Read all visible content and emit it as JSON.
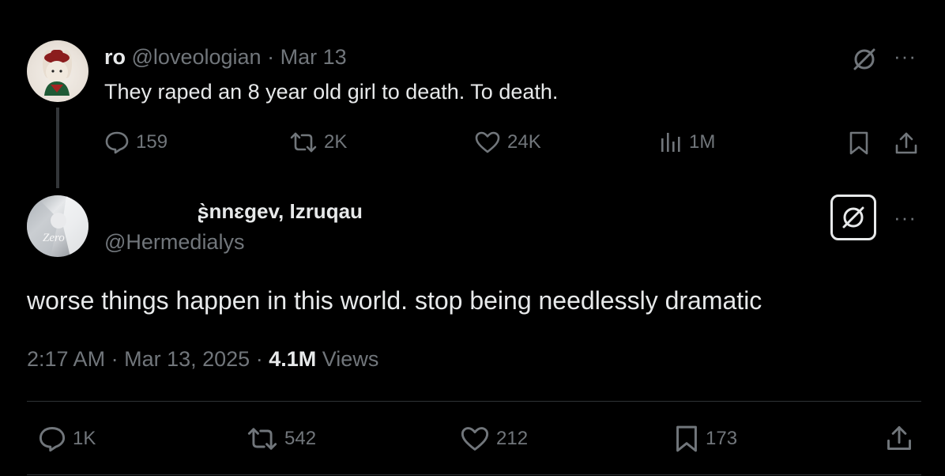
{
  "parent_tweet": {
    "display_name": "ro",
    "handle": "@loveologian",
    "separator": "·",
    "date": "Mar 13",
    "text": "They raped an 8 year old girl to death. To death.",
    "replies": "159",
    "reposts": "2K",
    "likes": "24K",
    "views": "1M"
  },
  "reply_tweet": {
    "display_name": "ʂ̀nnɛgev, Izruqau",
    "handle": "@Hermedialys",
    "text": "worse things happen in this world. stop being needlessly dramatic",
    "time": "2:17 AM",
    "separator": "·",
    "date": "Mar 13, 2025",
    "views_count": "4.1M",
    "views_label": "Views",
    "replies": "1K",
    "reposts": "542",
    "likes": "212",
    "bookmarks": "173"
  },
  "icons": {
    "reply": "comment-icon",
    "repost": "repost-icon",
    "like": "heart-icon",
    "views": "analytics-icon",
    "bookmark": "bookmark-icon",
    "share": "share-icon",
    "grok": "grok-icon",
    "more": "more-icon"
  },
  "colors": {
    "background": "#000000",
    "text_primary": "#e7e9ea",
    "text_secondary": "#71767b",
    "divider": "#2f3336"
  },
  "more_glyph": "···"
}
